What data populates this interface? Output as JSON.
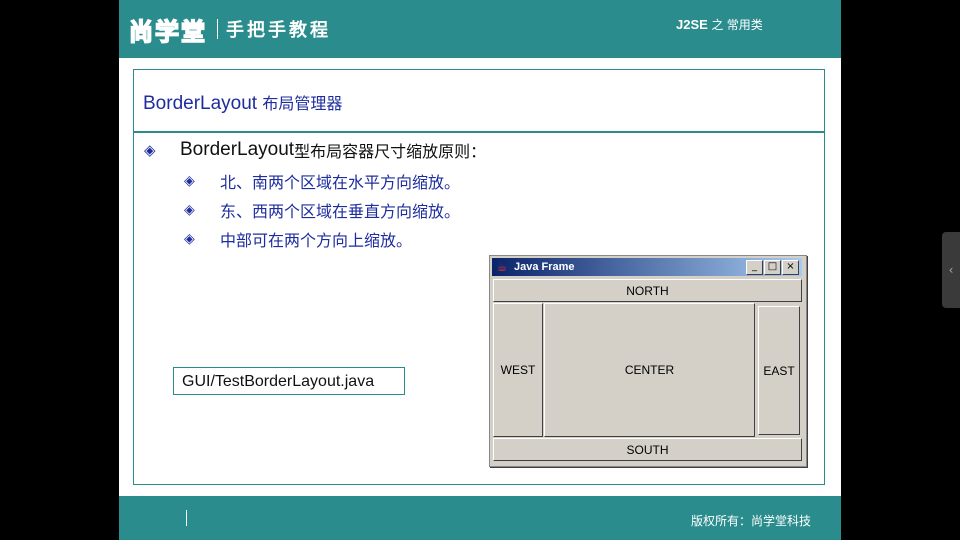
{
  "header": {
    "logo_text": "尚学堂",
    "logo_sub": "手把手教程",
    "course": "J2SE",
    "course_suffix": "之 常用类"
  },
  "slide": {
    "title_en": "BorderLayout",
    "title_zh": "布局管理器",
    "main_bullet_en": "BorderLayout",
    "main_bullet_zh": "型布局容器尺寸缩放原则：",
    "sub_bullets": [
      "北、南两个区域在水平方向缩放。",
      "东、西两个区域在垂直方向缩放。",
      "中部可在两个方向上缩放。"
    ],
    "file_label": "GUI/TestBorderLayout.java"
  },
  "java_frame": {
    "title": "Java Frame",
    "north": "NORTH",
    "west": "WEST",
    "center": "CENTER",
    "east": "EAST",
    "south": "SOUTH",
    "minimize": "_",
    "maximize": "□",
    "close": "×"
  },
  "footer": {
    "copyright": "版权所有：尚学堂科技"
  },
  "icons": {
    "bullet": "diamond-bullet-icon",
    "java": "java-cup-icon",
    "side": "chevron-left-icon"
  },
  "colors": {
    "teal": "#2a8c8c",
    "title_blue": "#1e2d9e"
  }
}
